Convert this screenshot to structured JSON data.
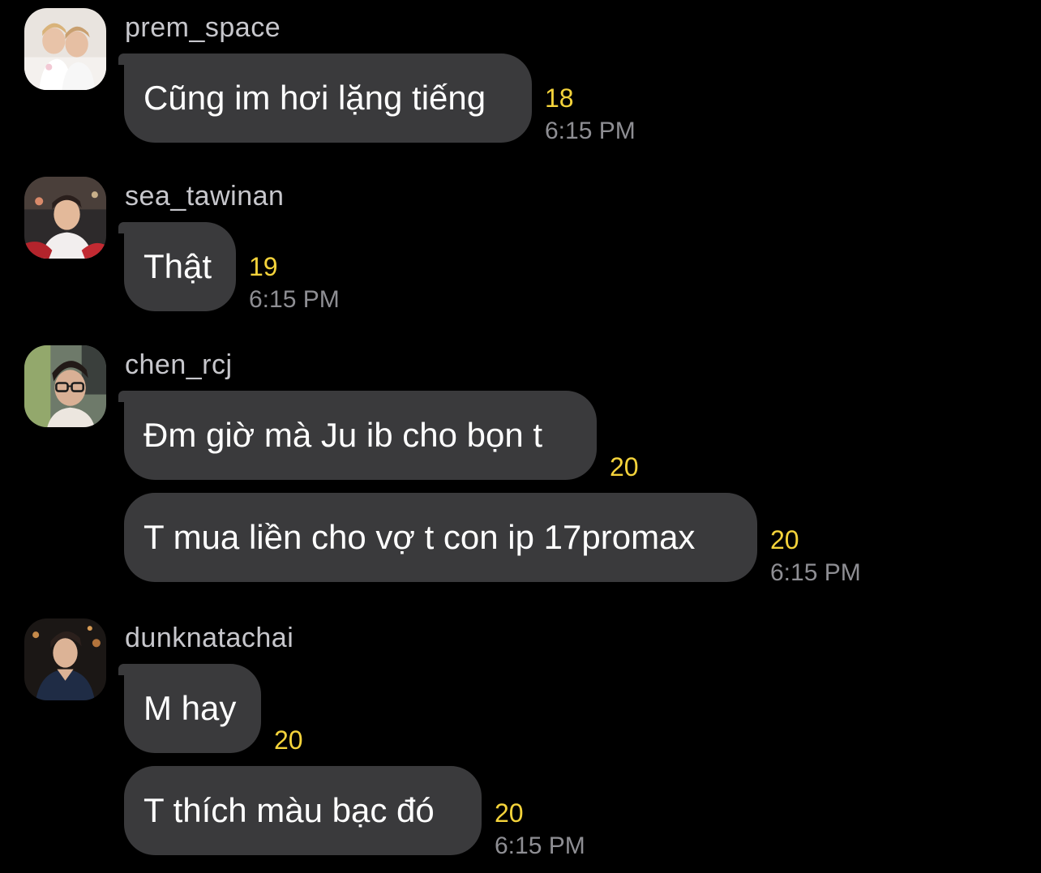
{
  "messages": [
    {
      "username": "prem_space",
      "avatar_icon": "avatar-two-people-photo",
      "bubbles": [
        {
          "text": "Cũng im hơi lặng tiếng",
          "count": "18",
          "time": "6:15 PM"
        }
      ]
    },
    {
      "username": "sea_tawinan",
      "avatar_icon": "avatar-person-photo",
      "bubbles": [
        {
          "text": "Thật",
          "count": "19",
          "time": "6:15 PM"
        }
      ]
    },
    {
      "username": "chen_rcj",
      "avatar_icon": "avatar-person-glasses-photo",
      "bubbles": [
        {
          "text": "Đm giờ mà Ju ib cho bọn t",
          "count": "20",
          "time": ""
        },
        {
          "text": "T mua liền cho vợ t con ip 17promax",
          "count": "20",
          "time": "6:15 PM"
        }
      ]
    },
    {
      "username": "dunknatachai",
      "avatar_icon": "avatar-person-dark-photo",
      "bubbles": [
        {
          "text": "M hay",
          "count": "20",
          "time": ""
        },
        {
          "text": "T thích màu bạc đó",
          "count": "20",
          "time": "6:15 PM"
        }
      ]
    }
  ],
  "colors": {
    "background": "#000000",
    "bubble": "#3a3a3c",
    "username": "#c7c7cc",
    "count": "#f4d33b",
    "time": "#8e8e93"
  }
}
